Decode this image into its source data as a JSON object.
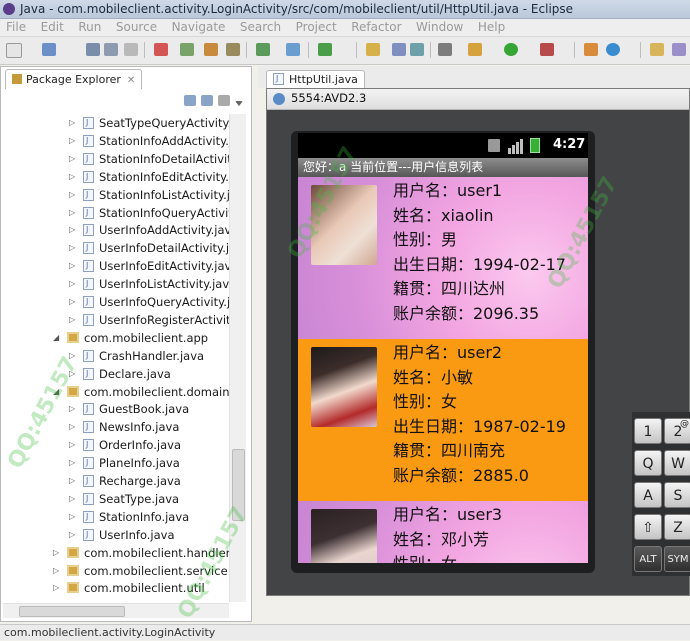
{
  "window": {
    "title": "Java - com.mobileclient.activity.LoginActivity/src/com/mobileclient/util/HttpUtil.java - Eclipse"
  },
  "menu": [
    "File",
    "Edit",
    "Run",
    "Source",
    "Navigate",
    "Search",
    "Project",
    "Refactor",
    "Window",
    "Help"
  ],
  "package_explorer": {
    "tab_label": "Package Explorer",
    "close_glyph": "✕",
    "rows": [
      {
        "label": "SeatTypeQueryActivity.ja",
        "type": "file",
        "expanded": false
      },
      {
        "label": "StationInfoAddActivity.jav",
        "type": "file",
        "expanded": false
      },
      {
        "label": "StationInfoDetailActivity.j",
        "type": "file",
        "expanded": false
      },
      {
        "label": "StationInfoEditActivity.jav",
        "type": "file",
        "expanded": false
      },
      {
        "label": "StationInfoListActivity.java",
        "type": "file",
        "expanded": false
      },
      {
        "label": "StationInfoQueryActivity.",
        "type": "file",
        "expanded": false
      },
      {
        "label": "UserInfoAddActivity.java",
        "type": "file",
        "expanded": false
      },
      {
        "label": "UserInfoDetailActivity.java",
        "type": "file",
        "expanded": false
      },
      {
        "label": "UserInfoEditActivity.java",
        "type": "file",
        "expanded": false
      },
      {
        "label": "UserInfoListActivity.java",
        "type": "file",
        "expanded": false
      },
      {
        "label": "UserInfoQueryActivity.java",
        "type": "file",
        "expanded": false
      },
      {
        "label": "UserInfoRegisterActivity.",
        "type": "file",
        "expanded": false
      },
      {
        "label": "com.mobileclient.app",
        "type": "package",
        "expanded": true
      },
      {
        "label": "CrashHandler.java",
        "type": "file",
        "expanded": false
      },
      {
        "label": "Declare.java",
        "type": "file",
        "expanded": false
      },
      {
        "label": "com.mobileclient.domain",
        "type": "package",
        "expanded": true
      },
      {
        "label": "GuestBook.java",
        "type": "file",
        "expanded": false
      },
      {
        "label": "NewsInfo.java",
        "type": "file",
        "expanded": false
      },
      {
        "label": "OrderInfo.java",
        "type": "file",
        "expanded": false
      },
      {
        "label": "PlaneInfo.java",
        "type": "file",
        "expanded": false
      },
      {
        "label": "Recharge.java",
        "type": "file",
        "expanded": false
      },
      {
        "label": "SeatType.java",
        "type": "file",
        "expanded": false
      },
      {
        "label": "StationInfo.java",
        "type": "file",
        "expanded": false
      },
      {
        "label": "UserInfo.java",
        "type": "file",
        "expanded": false
      },
      {
        "label": "com.mobileclient.handler",
        "type": "package",
        "expanded": false
      },
      {
        "label": "com.mobileclient.service",
        "type": "package",
        "expanded": false
      },
      {
        "label": "com.mobileclient.util",
        "type": "package",
        "expanded": false
      }
    ]
  },
  "editor": {
    "tab_label": "HttpUtil.java"
  },
  "emulator": {
    "title": "5554:AVD2.3",
    "status_time": "4:27",
    "header": "您好：a   当前位置---用户信息列表",
    "users": [
      {
        "lines": [
          "用户名：user1",
          "姓名：xiaolin",
          "性别：男",
          "出生日期：1994-02-17",
          "籍贯：四川达州",
          "账户余额：2096.35"
        ],
        "bg": "pink"
      },
      {
        "lines": [
          "用户名：user2",
          "姓名：小敏",
          "性别：女",
          "出生日期：1987-02-19",
          "籍贯：四川南充",
          "账户余额：2885.0"
        ],
        "bg": "orange"
      },
      {
        "lines": [
          "用户名：user3",
          "姓名：邓小芳",
          "性别：女"
        ],
        "bg": "pink"
      }
    ],
    "keys": [
      {
        "label": "1",
        "sub": "",
        "dark": false
      },
      {
        "label": "2",
        "sub": "@",
        "dark": false
      },
      {
        "label": "Q",
        "sub": "",
        "dark": false
      },
      {
        "label": "W",
        "sub": "",
        "dark": false
      },
      {
        "label": "A",
        "sub": "",
        "dark": false
      },
      {
        "label": "S",
        "sub": "",
        "dark": false
      },
      {
        "label": "⇧",
        "sub": "",
        "dark": false
      },
      {
        "label": "Z",
        "sub": "",
        "dark": false
      },
      {
        "label": "ALT",
        "sub": "",
        "dark": true
      },
      {
        "label": "SYM",
        "sub": "",
        "dark": true
      }
    ]
  },
  "statusbar": {
    "text": "com.mobileclient.activity.LoginActivity"
  },
  "watermark": {
    "text": "QQ:45157"
  }
}
